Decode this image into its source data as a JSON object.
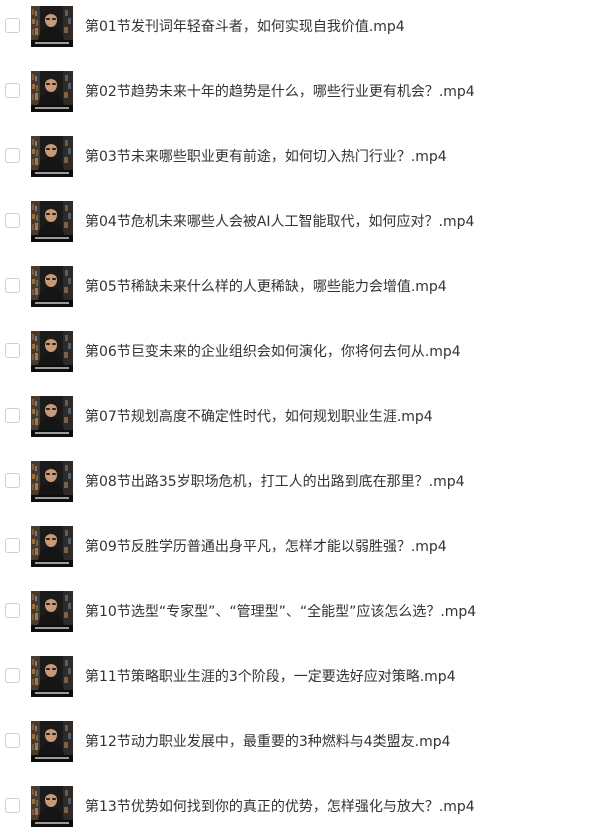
{
  "files": [
    {
      "name": "第01节发刊词年轻奋斗者，如何实现自我价值.mp4",
      "thumbnail": "video-thumbnail"
    },
    {
      "name": "第02节趋势未来十年的趋势是什么，哪些行业更有机会？.mp4",
      "thumbnail": "video-thumbnail"
    },
    {
      "name": "第03节未来哪些职业更有前途，如何切入热门行业？.mp4",
      "thumbnail": "video-thumbnail"
    },
    {
      "name": "第04节危机未来哪些人会被AI人工智能取代，如何应对？.mp4",
      "thumbnail": "video-thumbnail"
    },
    {
      "name": "第05节稀缺未来什么样的人更稀缺，哪些能力会增值.mp4",
      "thumbnail": "video-thumbnail"
    },
    {
      "name": "第06节巨变未来的企业组织会如何演化，你将何去何从.mp4",
      "thumbnail": "video-thumbnail"
    },
    {
      "name": "第07节规划高度不确定性时代，如何规划职业生涯.mp4",
      "thumbnail": "video-thumbnail"
    },
    {
      "name": "第08节出路35岁职场危机，打工人的出路到底在那里？.mp4",
      "thumbnail": "video-thumbnail"
    },
    {
      "name": "第09节反胜学历普通出身平凡，怎样才能以弱胜强？.mp4",
      "thumbnail": "video-thumbnail"
    },
    {
      "name": "第10节选型“专家型”、“管理型”、“全能型”应该怎么选？.mp4",
      "thumbnail": "video-thumbnail"
    },
    {
      "name": "第11节策略职业生涯的3个阶段，一定要选好应对策略.mp4",
      "thumbnail": "video-thumbnail"
    },
    {
      "name": "第12节动力职业发展中，最重要的3种燃料与4类盟友.mp4",
      "thumbnail": "video-thumbnail"
    },
    {
      "name": "第13节优势如何找到你的真正的优势，怎样强化与放大？.mp4",
      "thumbnail": "video-thumbnail"
    }
  ],
  "colors": {
    "text": "#333333",
    "checkbox_border": "#cfcfcf",
    "thumb_background": "#1b1b1b"
  }
}
